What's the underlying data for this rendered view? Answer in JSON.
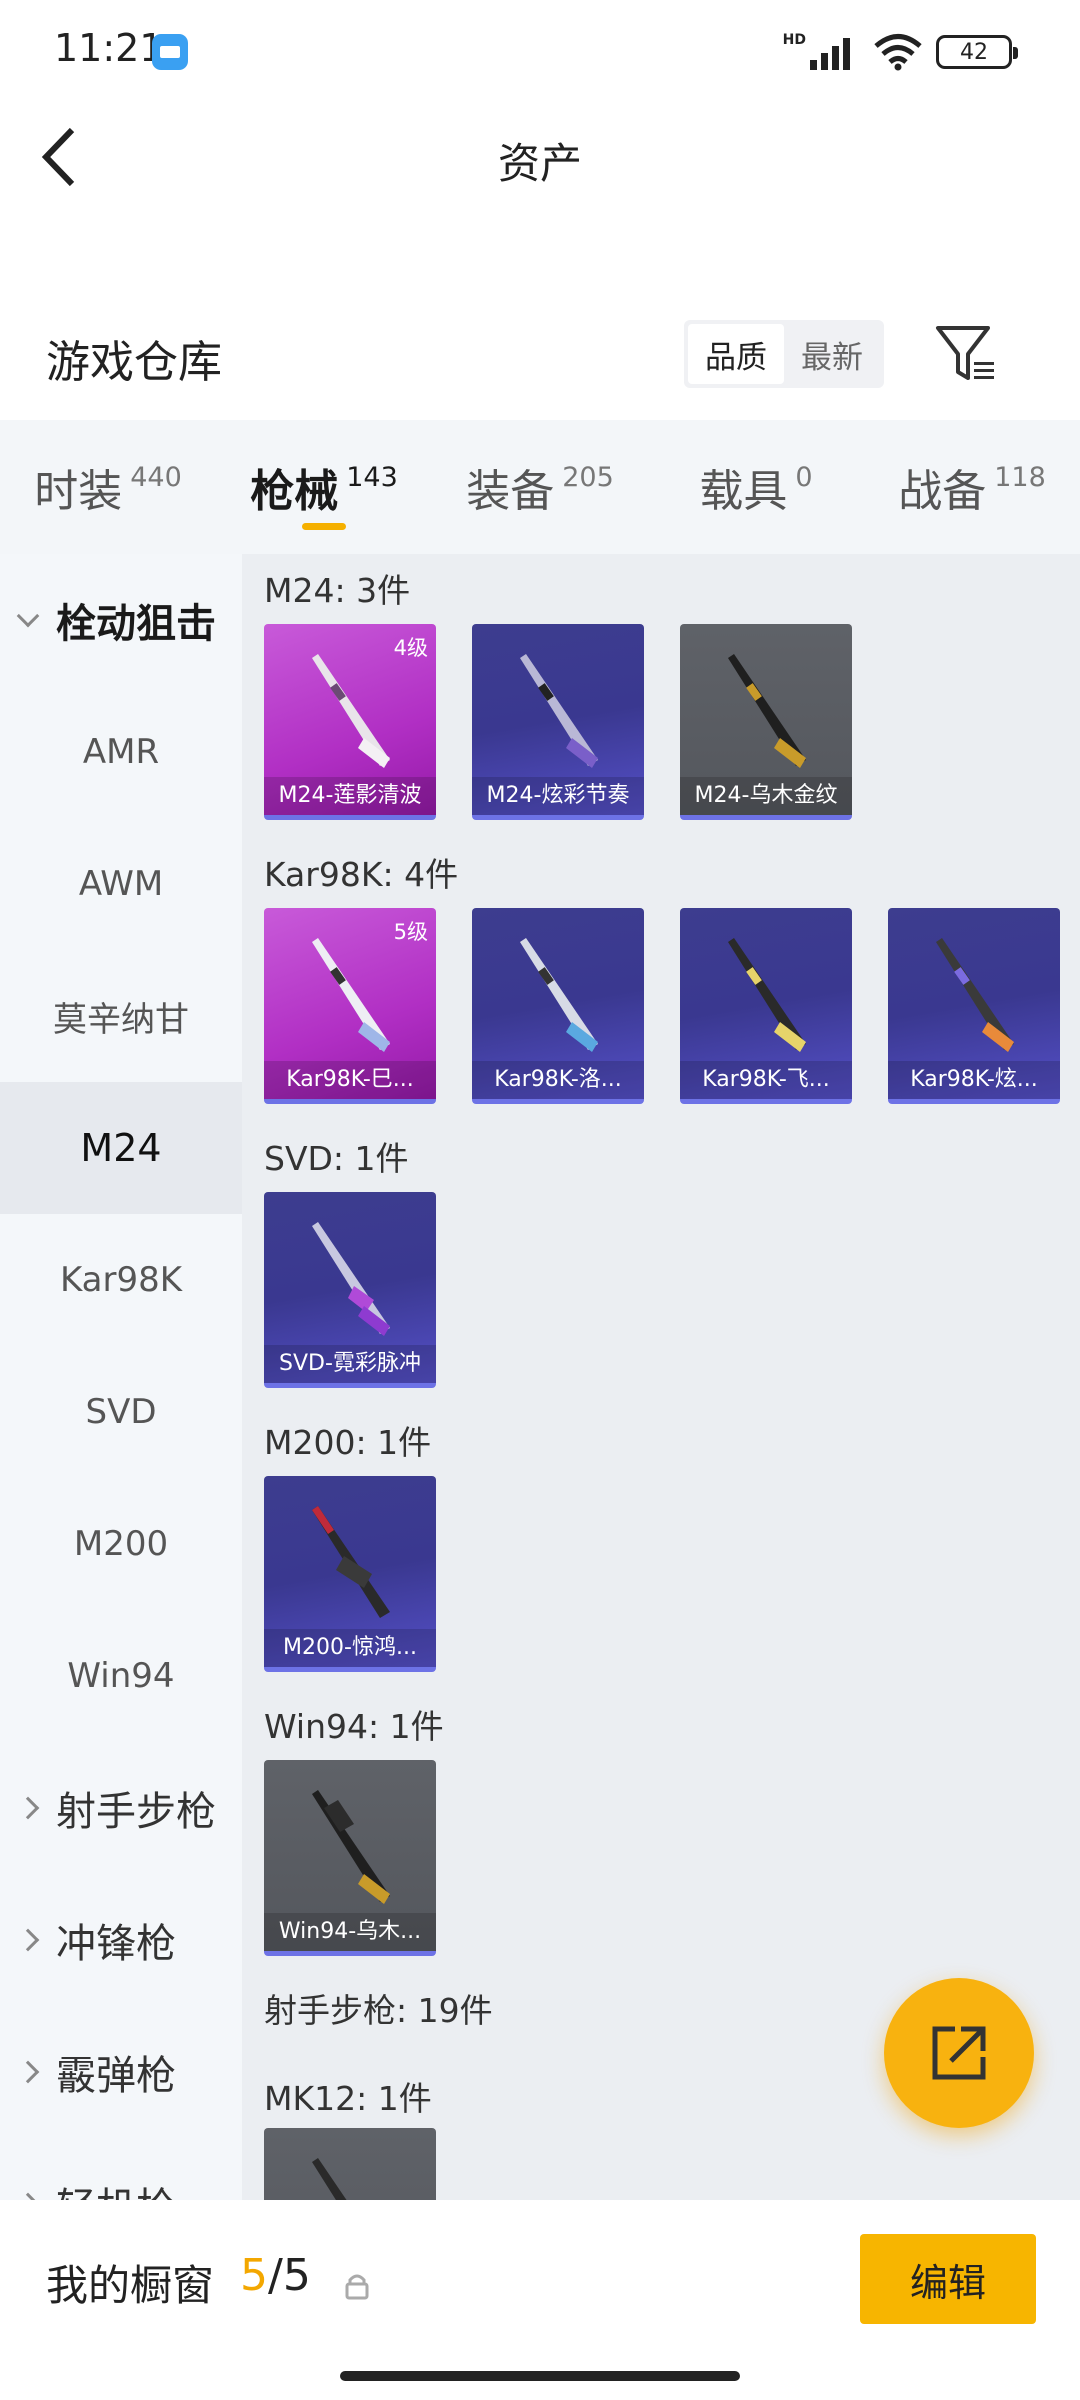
{
  "status": {
    "time": "11:21",
    "network": "HD",
    "battery": "42"
  },
  "header": {
    "title": "资产"
  },
  "warehouse": {
    "title": "游戏仓库",
    "sort_options": [
      "品质",
      "最新"
    ],
    "active_sort": "品质"
  },
  "tabs": [
    {
      "label": "时装",
      "count": "440"
    },
    {
      "label": "枪械",
      "count": "143"
    },
    {
      "label": "装备",
      "count": "205"
    },
    {
      "label": "载具",
      "count": "0"
    },
    {
      "label": "战备",
      "count": "118"
    }
  ],
  "active_tab": "枪械",
  "sidebar": {
    "items": [
      {
        "label": "栓动狙击",
        "type": "category",
        "expanded": true
      },
      {
        "label": "AMR",
        "type": "sub"
      },
      {
        "label": "AWM",
        "type": "sub"
      },
      {
        "label": "莫辛纳甘",
        "type": "sub"
      },
      {
        "label": "M24",
        "type": "sub",
        "selected": true
      },
      {
        "label": "Kar98K",
        "type": "sub"
      },
      {
        "label": "SVD",
        "type": "sub"
      },
      {
        "label": "M200",
        "type": "sub"
      },
      {
        "label": "Win94",
        "type": "sub"
      },
      {
        "label": "射手步枪",
        "type": "category"
      },
      {
        "label": "冲锋枪",
        "type": "category"
      },
      {
        "label": "霰弹枪",
        "type": "category"
      },
      {
        "label": "轻机枪",
        "type": "category"
      }
    ]
  },
  "groups": [
    {
      "title": "M24: 3件",
      "items": [
        {
          "name": "M24-莲影清波",
          "level": "4级",
          "rarity": "pink"
        },
        {
          "name": "M24-炫彩节奏",
          "rarity": "purple"
        },
        {
          "name": "M24-乌木金纹",
          "rarity": "gray"
        }
      ]
    },
    {
      "title": "Kar98K: 4件",
      "items": [
        {
          "name": "Kar98K-巳...",
          "level": "5级",
          "rarity": "pink"
        },
        {
          "name": "Kar98K-洛...",
          "rarity": "purple"
        },
        {
          "name": "Kar98K-飞...",
          "rarity": "purple"
        },
        {
          "name": "Kar98K-炫...",
          "rarity": "purple"
        }
      ]
    },
    {
      "title": "SVD: 1件",
      "items": [
        {
          "name": "SVD-霓彩脉冲",
          "rarity": "purple"
        }
      ]
    },
    {
      "title": "M200: 1件",
      "items": [
        {
          "name": "M200-惊鸿...",
          "rarity": "purple"
        }
      ]
    },
    {
      "title": "Win94: 1件",
      "items": [
        {
          "name": "Win94-乌木...",
          "rarity": "gray"
        }
      ]
    },
    {
      "title": "射手步枪: 19件",
      "items": []
    },
    {
      "title": "MK12: 1件",
      "items": [
        {
          "name": "",
          "rarity": "gray"
        }
      ]
    }
  ],
  "bottom": {
    "window_label": "我的橱窗",
    "window_current": "5",
    "window_total": "/5",
    "edit_label": "编辑"
  },
  "colors": {
    "accent": "#f7b500",
    "pink_rarity": "#b12fc4",
    "purple_rarity": "#3d3d8f",
    "gray_rarity": "#5a5d63"
  }
}
